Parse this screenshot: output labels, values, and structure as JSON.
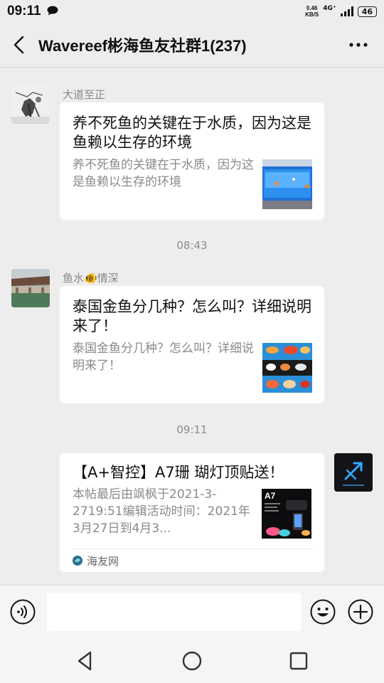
{
  "status_bar": {
    "time": "09:11",
    "net_speed_value": "0.46",
    "net_speed_unit": "KB/S",
    "network": "4G⁺",
    "battery": "46"
  },
  "header": {
    "title": "Wavereef彬海鱼友社群1(237)"
  },
  "messages": [
    {
      "sender": "大道至正",
      "title": "养不死鱼的关键在于水质，因为这是鱼赖以生存的环境",
      "description": "养不死鱼的关键在于水质，因为这是鱼赖以生存的环境"
    },
    {
      "time": "08:43",
      "sender": "鱼水🐠情深",
      "title": "泰国金鱼分几种？怎么叫？详细说明来了！",
      "description": "泰国金鱼分几种？怎么叫？详细说明来了！"
    },
    {
      "time": "09:11",
      "title": "【A+智控】A7珊 瑚灯顶贴送！",
      "description": "本帖最后由飒枫于2021-3-2719:51编辑活动时间：2021年3月27日到4月3...",
      "source": "海友网",
      "thumb_label": "A7"
    }
  ],
  "icons": {
    "back": "chevron-left-icon",
    "more": "more-icon",
    "voice": "voice-icon",
    "emoji": "emoji-icon",
    "add": "add-icon"
  }
}
